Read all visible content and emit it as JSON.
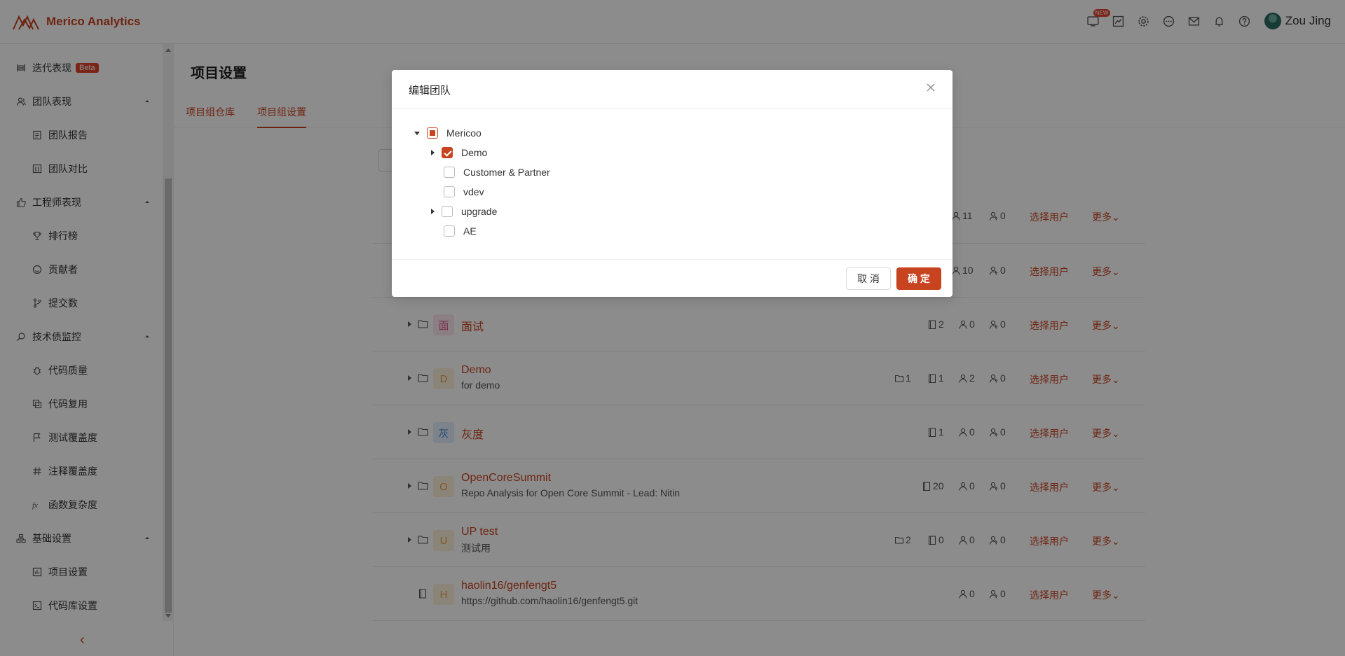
{
  "app": {
    "name": "Merico Analytics"
  },
  "header": {
    "new_badge": "NEW",
    "user_name": "Zou Jing"
  },
  "sidebar": {
    "items": [
      {
        "label": "迭代表现",
        "badge": "Beta",
        "icon": "iteration-icon"
      },
      {
        "label": "团队表现",
        "icon": "team-icon"
      },
      {
        "label": "团队报告",
        "icon": "report-icon"
      },
      {
        "label": "团队对比",
        "icon": "compare-icon"
      },
      {
        "label": "工程师表现",
        "icon": "thumb-up-icon"
      },
      {
        "label": "排行榜",
        "icon": "trophy-icon"
      },
      {
        "label": "贡献者",
        "icon": "smile-icon"
      },
      {
        "label": "提交数",
        "icon": "branch-icon"
      },
      {
        "label": "技术债监控",
        "icon": "monitor-icon"
      },
      {
        "label": "代码质量",
        "icon": "bug-icon"
      },
      {
        "label": "代码复用",
        "icon": "copy-icon"
      },
      {
        "label": "测试覆盖度",
        "icon": "flag-icon"
      },
      {
        "label": "注释覆盖度",
        "icon": "hash-icon"
      },
      {
        "label": "函数复杂度",
        "icon": "function-icon"
      },
      {
        "label": "基础设置",
        "icon": "settings-group-icon"
      },
      {
        "label": "项目设置",
        "icon": "project-settings-icon"
      },
      {
        "label": "代码库设置",
        "icon": "repo-settings-icon"
      }
    ]
  },
  "page": {
    "title": "项目设置",
    "tabs": [
      "项目组仓库",
      "项目组设置"
    ]
  },
  "rows": [
    {
      "members": "11",
      "admins": "0",
      "select": "选择用户",
      "more": "更多"
    },
    {
      "members": "10",
      "admins": "0",
      "select": "选择用户",
      "more": "更多"
    },
    {
      "avatar": "面",
      "name": "面试",
      "desc": "",
      "repos": "2",
      "members": "0",
      "admins": "0",
      "select": "选择用户",
      "more": "更多"
    },
    {
      "avatar": "D",
      "name": "Demo",
      "desc": "for demo",
      "folders": "1",
      "repos": "1",
      "members": "2",
      "admins": "0",
      "select": "选择用户",
      "more": "更多"
    },
    {
      "avatar": "灰",
      "name": "灰度",
      "desc": "",
      "repos": "1",
      "members": "0",
      "admins": "0",
      "select": "选择用户",
      "more": "更多"
    },
    {
      "avatar": "O",
      "name": "OpenCoreSummit",
      "desc": "Repo Analysis for Open Core Summit - Lead: Nitin",
      "repos": "20",
      "members": "0",
      "admins": "0",
      "select": "选择用户",
      "more": "更多"
    },
    {
      "avatar": "U",
      "name": "UP test",
      "desc": "测试用",
      "folders": "2",
      "repos": "0",
      "members": "0",
      "admins": "0",
      "select": "选择用户",
      "more": "更多"
    },
    {
      "avatar": "H",
      "name": "haolin16/genfengt5",
      "desc": "https://github.com/haolin16/genfengt5.git",
      "members": "0",
      "admins": "0",
      "select": "选择用户",
      "more": "更多"
    }
  ],
  "modal": {
    "title": "编辑团队",
    "tree": [
      {
        "label": "Mericoo",
        "state": "indeterminate",
        "expanded": true
      },
      {
        "label": "Demo",
        "state": "checked",
        "expanded": false
      },
      {
        "label": "Customer & Partner",
        "state": "unchecked"
      },
      {
        "label": "vdev",
        "state": "unchecked"
      },
      {
        "label": "upgrade",
        "state": "unchecked",
        "expanded": false
      },
      {
        "label": "AE",
        "state": "unchecked"
      }
    ],
    "cancel": "取 消",
    "ok": "确 定"
  },
  "colors": {
    "accent": "#c8431f"
  }
}
